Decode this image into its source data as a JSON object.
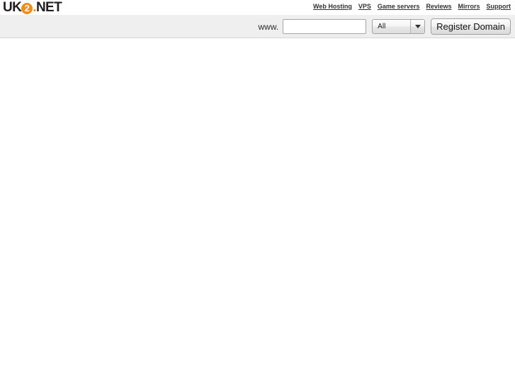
{
  "logo": {
    "part1": "UK",
    "badge": "2",
    "dot": ".",
    "part2": "NET",
    "accent_color": "#f28c1a",
    "text_color": "#231f20"
  },
  "nav": {
    "items": [
      {
        "label": "Web Hosting"
      },
      {
        "label": "VPS"
      },
      {
        "label": "Game servers"
      },
      {
        "label": "Reviews"
      },
      {
        "label": "Mirrors"
      },
      {
        "label": "Support"
      }
    ]
  },
  "search": {
    "prefix_label": "www.",
    "input_value": "",
    "input_placeholder": "",
    "tld_selected": "All",
    "tld_options": [
      "All"
    ],
    "submit_label": "Register Domain",
    "bar_background": "#efefef"
  }
}
